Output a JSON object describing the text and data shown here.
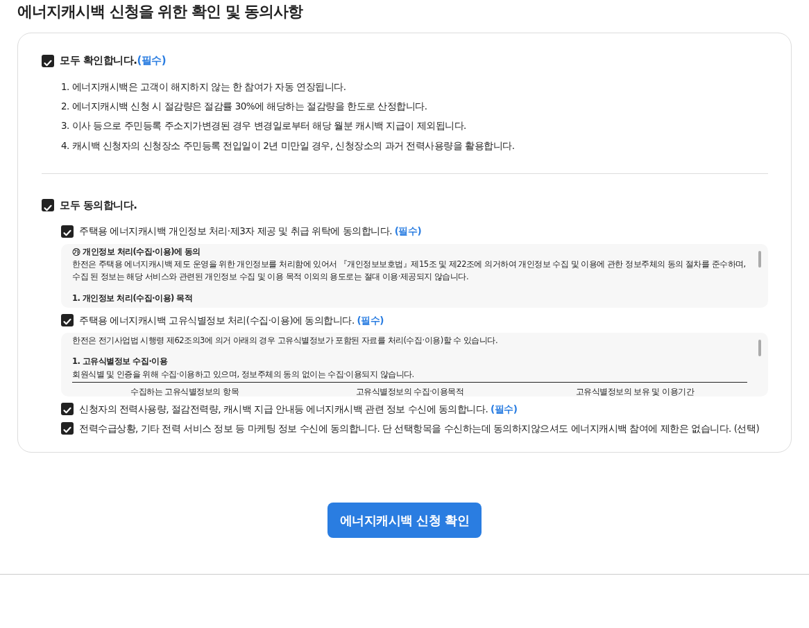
{
  "title": "에너지캐시백 신청을 위한 확인 및 동의사항",
  "confirm_all": {
    "label": "모두 확인합니다.",
    "tag": "(필수)",
    "checked": true
  },
  "notices": [
    "1. 에너지캐시백은 고객이 해지하지 않는 한 참여가 자동 연장됩니다.",
    "2. 에너지캐시백 신청 시 절감량은 절감률 30%에 해당하는 절감량을 한도로 산정합니다.",
    "3. 이사 등으로 주민등록 주소지가변경된 경우 변경일로부터 해당 월분 캐시백 지급이 제외됩니다.",
    "4. 캐시백 신청자의 신청장소 주민등록 전입일이 2년 미만일 경우, 신청장소의 과거 전력사용량을 활용합니다."
  ],
  "agree_all": {
    "label": "모두 동의합니다.",
    "checked": true
  },
  "consents": [
    {
      "label": "주택용 에너지캐시백 개인정보 처리·제3자 제공 및 취급 위탁에 동의합니다.",
      "tag": "(필수)",
      "required": true,
      "checked": true,
      "terms": [
        {
          "kind": "heading",
          "text": "㉮ 개인정보 처리(수집·이용)에 동의"
        },
        {
          "kind": "paragraph",
          "text": "한전은 주택용 에너지캐시백 제도 운영을 위한 개인정보를 처리함에 있어서 『개인정보보호법』제15조 및 제22조에 의거하여 개인정보 수집 및 이용에 관한 정보주체의 동의 절차를 준수하며, 수집 된 정보는 해당 서비스와 관련된 개인정보 수집 및 이용 목적 이외의 용도로는 절대 이용·제공되지 않습니다."
        },
        {
          "kind": "heading",
          "text": "1. 개인정보 처리(수집·이용) 목적"
        }
      ]
    },
    {
      "label": "주택용 에너지캐시백 고유식별정보 처리(수집·이용)에 동의합니다.",
      "tag": "(필수)",
      "required": true,
      "checked": true,
      "terms": [
        {
          "kind": "paragraph",
          "text": "한전은 전기사업법 시행령 제62조의3에 의거 아래의 경우 고유식별정보가 포함된 자료를 처리(수집·이용)할 수 있습니다."
        },
        {
          "kind": "heading",
          "text": "1. 고유식별정보 수집·이용"
        },
        {
          "kind": "note",
          "text": "회원식별 및 인증을 위해 수집·이용하고 있으며, 정보주체의 동의 없이는 수집·이용되지 않습니다."
        },
        {
          "kind": "table_header",
          "columns": [
            "수집하는 고유식별정보의 항목",
            "고유식별정보의 수집·이용목적",
            "고유식별정보의 보유 및 이용기간"
          ]
        }
      ]
    },
    {
      "label": "신청자의 전력사용량, 절감전력량, 캐시백 지급 안내등 에너지캐시백 관련 정보 수신에 동의합니다.",
      "tag": "(필수)",
      "required": true,
      "checked": true
    },
    {
      "label": "전력수급상황, 기타 전력 서비스 정보 등 마케팅 정보 수신에 동의합니다. 단 선택항목을 수신하는데 동의하지않으셔도 에너지캐시백 참여에 제한은 없습니다.",
      "tag": "(선택)",
      "required": false,
      "checked": true
    }
  ],
  "submit_button": "에너지캐시백 신청 확인"
}
